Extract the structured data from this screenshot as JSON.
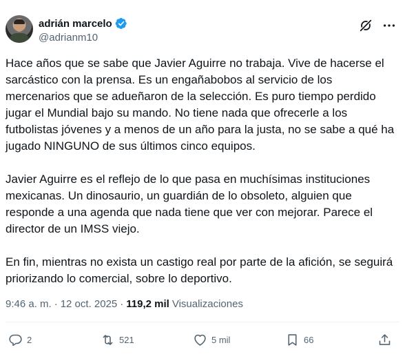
{
  "author": {
    "display_name": "adrián marcelo",
    "handle": "@adrianm10",
    "verified": true
  },
  "icons": {
    "verified": "verified-badge-icon",
    "grok": "grok-icon",
    "more": "more-icon",
    "reply": "reply-icon",
    "repost": "repost-icon",
    "like": "heart-icon",
    "bookmark": "bookmark-icon",
    "share": "share-icon"
  },
  "tweet": {
    "paragraphs": [
      "Hace años que se sabe que Javier Aguirre no trabaja. Vive de hacerse el sarcástico con la prensa. Es un engañabobos al servicio de los mercenarios que se adueñaron de la selección. Es puro tiempo perdido jugar el Mundial bajo su mando. No tiene nada que ofrecerle a los futbolistas jóvenes y a menos de un año para la justa, no se sabe a qué ha jugado NINGUNO de sus últimos cinco equipos.",
      "Javier Aguirre es el reflejo de lo que pasa en muchísimas instituciones mexicanas. Un dinosaurio, un guardián de lo obsoleto, alguien que responde a una agenda que nada tiene que ver con mejorar. Parece el director de un IMSS viejo.",
      "En fin, mientras no exista un castigo real por parte de la afición, se seguirá priorizando lo comercial, sobre lo deportivo."
    ],
    "time": "9:46 a. m.",
    "separator": "·",
    "date": "12 oct. 2025",
    "views_count": "119,2 mil",
    "views_label": "Visualizaciones"
  },
  "actions": {
    "replies": "2",
    "reposts": "521",
    "likes": "5 mil",
    "bookmarks": "66"
  },
  "colors": {
    "text": "#0f1419",
    "secondary": "#536471",
    "verified": "#1d9bf0",
    "divider": "#eff3f4"
  }
}
